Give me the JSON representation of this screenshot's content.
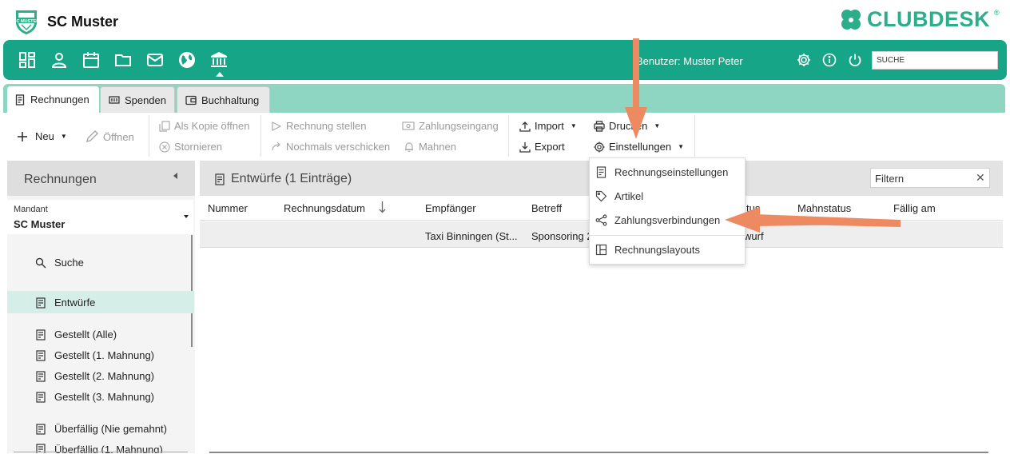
{
  "app": {
    "club_name": "SC Muster",
    "brand": "CLUBDESK",
    "brand_mark": "®"
  },
  "nav": {
    "icons": [
      "dashboard-icon",
      "person-icon",
      "calendar-icon",
      "folder-icon",
      "mail-icon",
      "globe-icon",
      "bank-icon"
    ],
    "user_label": "Benutzer: Muster Peter",
    "search_value": "SUCHE"
  },
  "tabs": [
    {
      "label": "Rechnungen",
      "icon": "invoice-icon",
      "active": true
    },
    {
      "label": "Spenden",
      "icon": "donation-icon",
      "active": false
    },
    {
      "label": "Buchhaltung",
      "icon": "wallet-icon",
      "active": false
    }
  ],
  "toolbar": {
    "new": "Neu",
    "open": "Öffnen",
    "copy_open": "Als Kopie öffnen",
    "cancel": "Stornieren",
    "issue_invoice": "Rechnung stellen",
    "resend": "Nochmals verschicken",
    "payment_in": "Zahlungseingang",
    "dun": "Mahnen",
    "import": "Import",
    "export": "Export",
    "print": "Drucken",
    "settings": "Einstellungen"
  },
  "sidebar": {
    "title": "Rechnungen",
    "mandant_label": "Mandant",
    "mandant_value": "SC Muster",
    "items": [
      {
        "label": "Suche",
        "icon": "search-icon"
      },
      {
        "label": "Entwürfe",
        "icon": "invoice-icon",
        "selected": true
      },
      {
        "label": "Gestellt (Alle)",
        "icon": "invoice-icon"
      },
      {
        "label": "Gestellt (1. Mahnung)",
        "icon": "invoice-icon"
      },
      {
        "label": "Gestellt (2. Mahnung)",
        "icon": "invoice-icon"
      },
      {
        "label": "Gestellt (3. Mahnung)",
        "icon": "invoice-icon"
      },
      {
        "label": "Überfällig (Nie gemahnt)",
        "icon": "invoice-icon"
      },
      {
        "label": "Überfällig (1. Mahnung)",
        "icon": "invoice-icon"
      }
    ]
  },
  "content": {
    "title": "Entwürfe (1 Einträge)",
    "filter_placeholder": "Filtern",
    "columns": [
      "Nummer",
      "Rechnungsdatum",
      "Empfänger",
      "Betreff",
      "tus",
      "Mahnstatus",
      "Fällig am"
    ],
    "rows": [
      {
        "empfaenger": "Taxi Binningen (St...",
        "betreff": "Sponsoring 2",
        "status": "wurf"
      }
    ]
  },
  "settings_menu": {
    "items": [
      {
        "label": "Rechnungseinstellungen",
        "icon": "invoice-icon"
      },
      {
        "label": "Artikel",
        "icon": "tag-icon"
      },
      {
        "label": "Zahlungsverbindungen",
        "icon": "share-icon"
      },
      {
        "label": "Rechnungslayouts",
        "icon": "layout-icon"
      }
    ]
  },
  "colors": {
    "primary": "#17a587",
    "tabbar": "#8ed6c2",
    "selected": "#d5efe8",
    "annotation_arrow": "#ee8a62"
  }
}
